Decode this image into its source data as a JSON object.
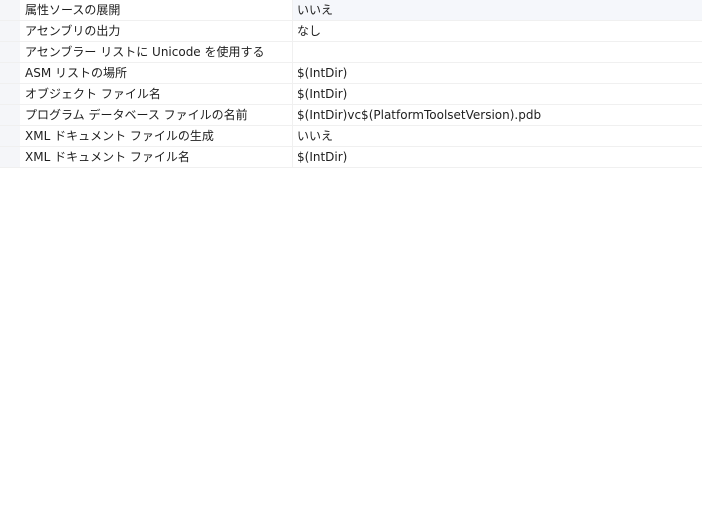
{
  "properties": [
    {
      "name": "属性ソースの展開",
      "value": "いいえ"
    },
    {
      "name": "アセンブリの出力",
      "value": "なし"
    },
    {
      "name": "アセンブラー リストに Unicode を使用する",
      "value": ""
    },
    {
      "name": "ASM リストの場所",
      "value": "$(IntDir)"
    },
    {
      "name": "オブジェクト ファイル名",
      "value": "$(IntDir)"
    },
    {
      "name": "プログラム データベース ファイルの名前",
      "value": "$(IntDir)vc$(PlatformToolsetVersion).pdb"
    },
    {
      "name": "XML ドキュメント ファイルの生成",
      "value": "いいえ"
    },
    {
      "name": "XML ドキュメント ファイル名",
      "value": "$(IntDir)"
    }
  ]
}
